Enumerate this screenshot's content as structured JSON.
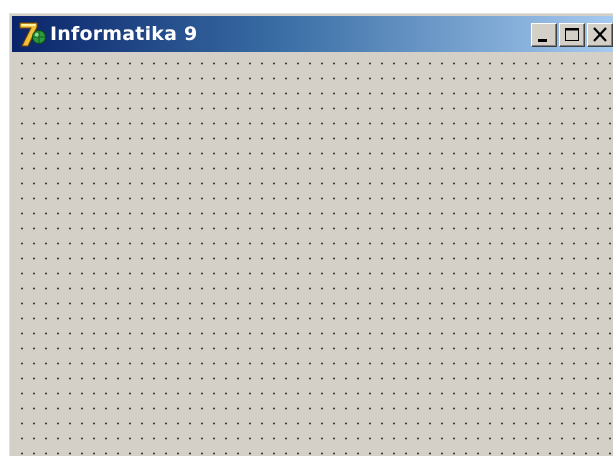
{
  "window": {
    "title": "Informatika 9",
    "app_icon": "informatika-logo-icon",
    "caption_buttons": [
      {
        "name": "minimize-button",
        "icon": "minimize-icon"
      },
      {
        "name": "maximize-button",
        "icon": "maximize-icon"
      },
      {
        "name": "close-button",
        "icon": "close-icon"
      }
    ]
  },
  "client_area": {
    "grid": "dot-grid"
  },
  "colors": {
    "titlebar_start": "#0a246a",
    "titlebar_end": "#a6caf0",
    "face": "#d4d0c8",
    "title_text": "#ffffff"
  }
}
